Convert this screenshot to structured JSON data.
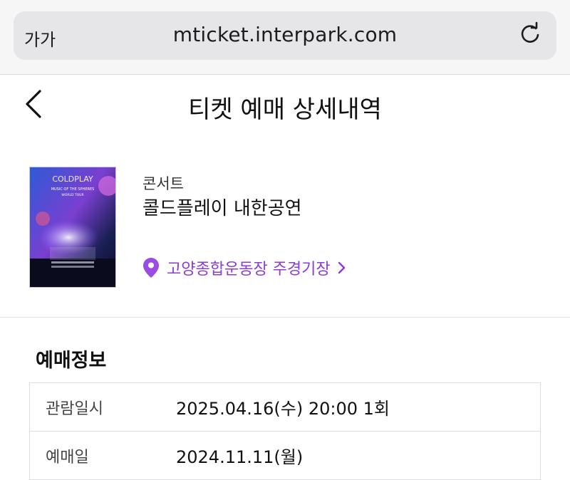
{
  "browser": {
    "text_size_label": "가가",
    "url": "mticket.interpark.com"
  },
  "header": {
    "title": "티켓 예매 상세내역"
  },
  "show": {
    "category": "콘서트",
    "title": "콜드플레이 내한공연",
    "poster_text": {
      "band": "COLDPLAY",
      "tour": "MUSIC OF THE SPHERES",
      "sub": "WORLD TOUR"
    },
    "venue": "고양종합운동장 주경기장"
  },
  "booking": {
    "section_title": "예매정보",
    "rows": [
      {
        "label": "관람일시",
        "value": "2025.04.16(수) 20:00 1회"
      },
      {
        "label": "예매일",
        "value": "2024.11.11(월)"
      }
    ]
  },
  "colors": {
    "accent": "#8a3bd8",
    "url_bar": "#e6e6e9"
  }
}
